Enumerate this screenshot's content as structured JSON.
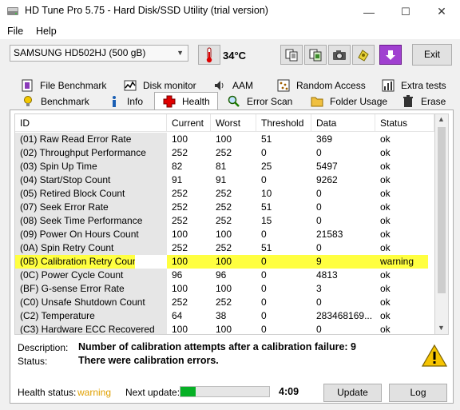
{
  "window": {
    "title": "HD Tune Pro 5.75 - Hard Disk/SSD Utility (trial version)",
    "minimize": "—",
    "maximize": "☐",
    "close": "✕"
  },
  "menu": {
    "file": "File",
    "help": "Help"
  },
  "toolbar": {
    "drive": "SAMSUNG HD502HJ (500 gB)",
    "temperature": "34°C",
    "exit": "Exit",
    "icons": [
      "thermometer-icon",
      "copy-text-icon",
      "copy-screen-icon",
      "camera-icon",
      "disk-tool-icon",
      "download-icon"
    ]
  },
  "tabs": {
    "row1": [
      {
        "label": "File Benchmark",
        "icon": "file-benchmark-icon"
      },
      {
        "label": "Disk monitor",
        "icon": "disk-monitor-icon"
      },
      {
        "label": "AAM",
        "icon": "speaker-icon"
      },
      {
        "label": "Random Access",
        "icon": "random-access-icon"
      },
      {
        "label": "Extra tests",
        "icon": "extra-tests-icon"
      }
    ],
    "row2": [
      {
        "label": "Benchmark",
        "icon": "benchmark-icon"
      },
      {
        "label": "Info",
        "icon": "info-icon"
      },
      {
        "label": "Health",
        "icon": "health-cross-icon",
        "active": true
      },
      {
        "label": "Error Scan",
        "icon": "magnifier-icon"
      },
      {
        "label": "Folder Usage",
        "icon": "folder-icon"
      },
      {
        "label": "Erase",
        "icon": "trash-icon"
      }
    ]
  },
  "table": {
    "columns": [
      "ID",
      "Current",
      "Worst",
      "Threshold",
      "Data",
      "Status"
    ],
    "rows": [
      [
        "(01) Raw Read Error Rate",
        "100",
        "100",
        "51",
        "369",
        "ok"
      ],
      [
        "(02) Throughput Performance",
        "252",
        "252",
        "0",
        "0",
        "ok"
      ],
      [
        "(03) Spin Up Time",
        "82",
        "81",
        "25",
        "5497",
        "ok"
      ],
      [
        "(04) Start/Stop Count",
        "91",
        "91",
        "0",
        "9262",
        "ok"
      ],
      [
        "(05) Retired Block Count",
        "252",
        "252",
        "10",
        "0",
        "ok"
      ],
      [
        "(07) Seek Error Rate",
        "252",
        "252",
        "51",
        "0",
        "ok"
      ],
      [
        "(08) Seek Time Performance",
        "252",
        "252",
        "15",
        "0",
        "ok"
      ],
      [
        "(09) Power On Hours Count",
        "100",
        "100",
        "0",
        "21583",
        "ok"
      ],
      [
        "(0A) Spin Retry Count",
        "252",
        "252",
        "51",
        "0",
        "ok"
      ],
      [
        "(0B) Calibration Retry Count",
        "100",
        "100",
        "0",
        "9",
        "warning"
      ],
      [
        "(0C) Power Cycle Count",
        "96",
        "96",
        "0",
        "4813",
        "ok"
      ],
      [
        "(BF) G-sense Error Rate",
        "100",
        "100",
        "0",
        "3",
        "ok"
      ],
      [
        "(C0) Unsafe Shutdown Count",
        "252",
        "252",
        "0",
        "0",
        "ok"
      ],
      [
        "(C2) Temperature",
        "64",
        "38",
        "0",
        "283468169...",
        "ok"
      ],
      [
        "(C3) Hardware ECC Recovered",
        "100",
        "100",
        "0",
        "0",
        "ok"
      ]
    ],
    "warning_row": 9
  },
  "details": {
    "description_label": "Description:",
    "description": "Number of calibration attempts after a calibration failure: 9",
    "status_label": "Status:",
    "status": "There were calibration errors."
  },
  "footer": {
    "health_label": "Health status:",
    "health_value": "warning",
    "next_update_label": "Next update:",
    "progress": 0.17,
    "time": "4:09",
    "update": "Update",
    "log": "Log"
  },
  "colors": {
    "warning_row": "#ffff40",
    "warning_text": "#e0a000",
    "progress": "#06b025"
  }
}
